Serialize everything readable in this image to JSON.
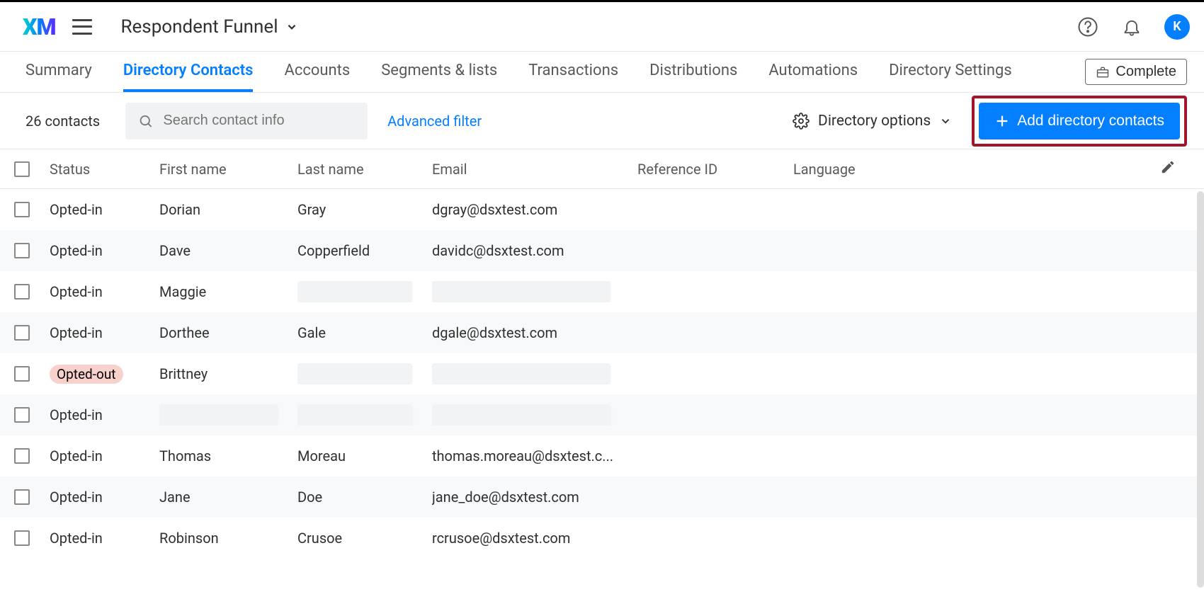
{
  "header": {
    "logo_text": "XM",
    "project_name": "Respondent Funnel",
    "avatar_letter": "K"
  },
  "tabs": [
    {
      "label": "Summary",
      "active": false
    },
    {
      "label": "Directory Contacts",
      "active": true
    },
    {
      "label": "Accounts",
      "active": false
    },
    {
      "label": "Segments & lists",
      "active": false
    },
    {
      "label": "Transactions",
      "active": false
    },
    {
      "label": "Distributions",
      "active": false
    },
    {
      "label": "Automations",
      "active": false
    },
    {
      "label": "Directory Settings",
      "active": false
    }
  ],
  "complete_button_label": "Complete",
  "toolbar": {
    "count_label": "26 contacts",
    "search_placeholder": "Search contact info",
    "advanced_filter_label": "Advanced filter",
    "directory_options_label": "Directory options",
    "add_button_label": "Add directory contacts"
  },
  "columns": {
    "status": "Status",
    "first_name": "First name",
    "last_name": "Last name",
    "email": "Email",
    "reference_id": "Reference ID",
    "language": "Language"
  },
  "rows": [
    {
      "status": "Opted-in",
      "first_name": "Dorian",
      "last_name": "Gray",
      "email": "dgray@dsxtest.com",
      "reference_id": "",
      "language": "",
      "status_out": false,
      "redacted": false
    },
    {
      "status": "Opted-in",
      "first_name": "Dave",
      "last_name": "Copperfield",
      "email": "davidc@dsxtest.com",
      "reference_id": "",
      "language": "",
      "status_out": false,
      "redacted": false
    },
    {
      "status": "Opted-in",
      "first_name": "Maggie",
      "last_name": "",
      "email": "",
      "reference_id": "",
      "language": "",
      "status_out": false,
      "redacted": true
    },
    {
      "status": "Opted-in",
      "first_name": "Dorthee",
      "last_name": "Gale",
      "email": "dgale@dsxtest.com",
      "reference_id": "",
      "language": "",
      "status_out": false,
      "redacted": false
    },
    {
      "status": "Opted-out",
      "first_name": "Brittney",
      "last_name": "",
      "email": "",
      "reference_id": "",
      "language": "",
      "status_out": true,
      "redacted": true
    },
    {
      "status": "Opted-in",
      "first_name": "",
      "last_name": "",
      "email": "",
      "reference_id": "",
      "language": "",
      "status_out": false,
      "redacted": true,
      "redact_first": true
    },
    {
      "status": "Opted-in",
      "first_name": "Thomas",
      "last_name": "Moreau",
      "email": "thomas.moreau@dsxtest.c...",
      "reference_id": "",
      "language": "",
      "status_out": false,
      "redacted": false
    },
    {
      "status": "Opted-in",
      "first_name": "Jane",
      "last_name": "Doe",
      "email": "jane_doe@dsxtest.com",
      "reference_id": "",
      "language": "",
      "status_out": false,
      "redacted": false
    },
    {
      "status": "Opted-in",
      "first_name": "Robinson",
      "last_name": "Crusoe",
      "email": "rcrusoe@dsxtest.com",
      "reference_id": "",
      "language": "",
      "status_out": false,
      "redacted": false
    }
  ]
}
